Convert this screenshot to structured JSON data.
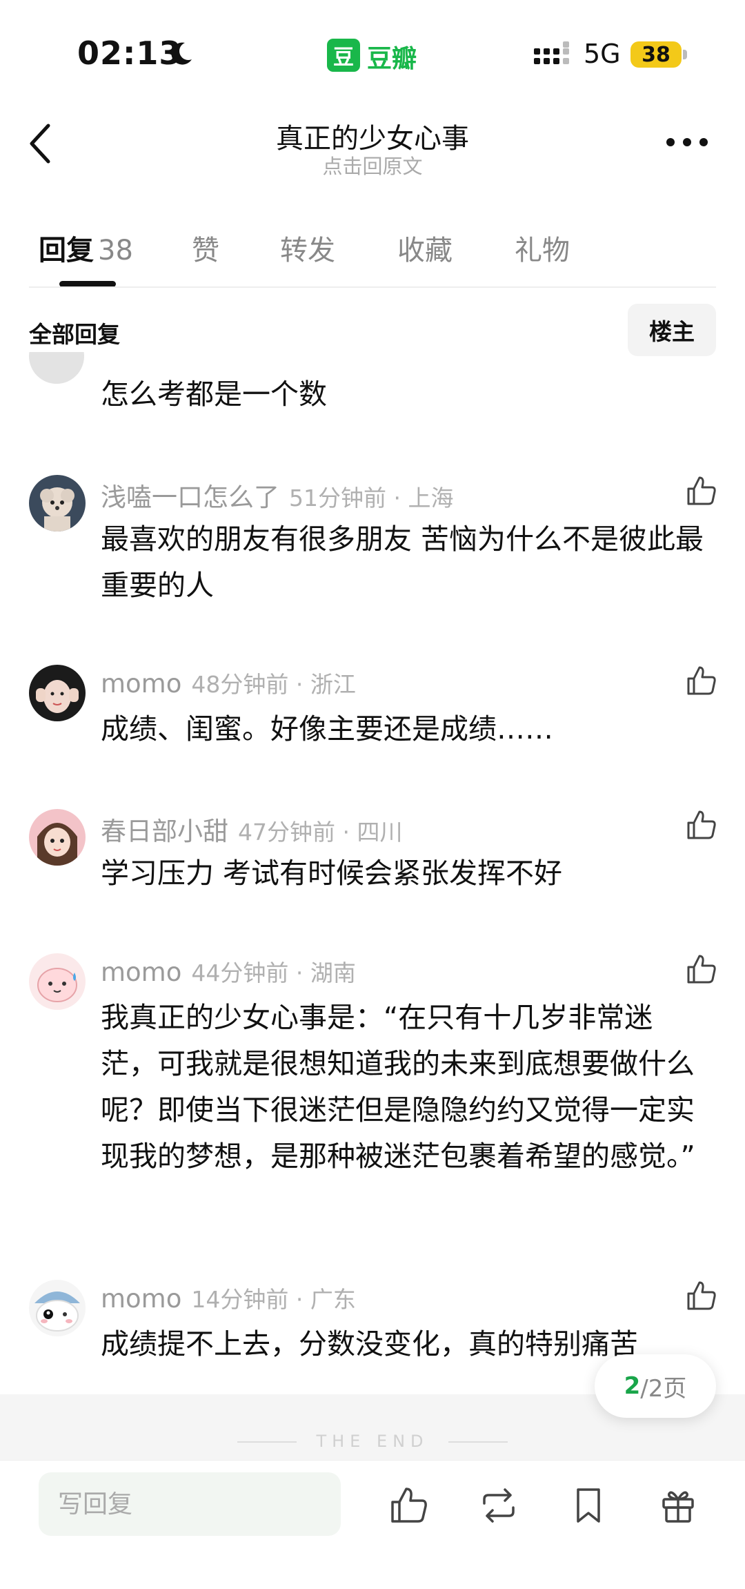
{
  "status_bar": {
    "time": "02:13",
    "app_badge": "豆",
    "app_name": "豆瓣",
    "network": "5G",
    "battery": "38"
  },
  "header": {
    "title": "真正的少女心事",
    "subtitle": "点击回原文"
  },
  "tabs": [
    {
      "label": "回复",
      "count": "38"
    },
    {
      "label": "赞"
    },
    {
      "label": "转发"
    },
    {
      "label": "收藏"
    },
    {
      "label": "礼物"
    }
  ],
  "section": {
    "label": "全部回复",
    "owner_button": "楼主"
  },
  "comments": [
    {
      "body": "怎么考都是一个数"
    },
    {
      "author": "浅嗑一口怎么了",
      "time": "51分钟前 · 上海",
      "body": "最喜欢的朋友有很多朋友 苦恼为什么不是彼此最重要的人"
    },
    {
      "author": "momo",
      "time": "48分钟前 · 浙江",
      "body": "成绩、闺蜜。好像主要还是成绩……"
    },
    {
      "author": "春日部小甜",
      "time": "47分钟前 · 四川",
      "body": "学习压力 考试有时候会紧张发挥不好"
    },
    {
      "author": "momo",
      "time": "44分钟前 · 湖南",
      "body": "我真正的少女心事是：“在只有十几岁非常迷茫，可我就是很想知道我的未来到底想要做什么呢？即使当下很迷茫但是隐隐约约又觉得一定实现我的梦想，是那种被迷茫包裹着希望的感觉。”"
    },
    {
      "author": "momo",
      "time": "14分钟前 · 广东",
      "body": "成绩提不上去，分数没变化，真的特别痛苦"
    }
  ],
  "pager": {
    "current": "2",
    "total": "/2页"
  },
  "end_text": "THE END",
  "bottom_bar": {
    "reply_placeholder": "写回复"
  },
  "icons": {
    "like": "thumbs-up-icon",
    "repost": "repost-icon",
    "bookmark": "bookmark-icon",
    "gift": "gift-icon"
  },
  "colors": {
    "accent": "#19b74a",
    "battery": "#f3c919",
    "pager_current": "#19a54a"
  }
}
